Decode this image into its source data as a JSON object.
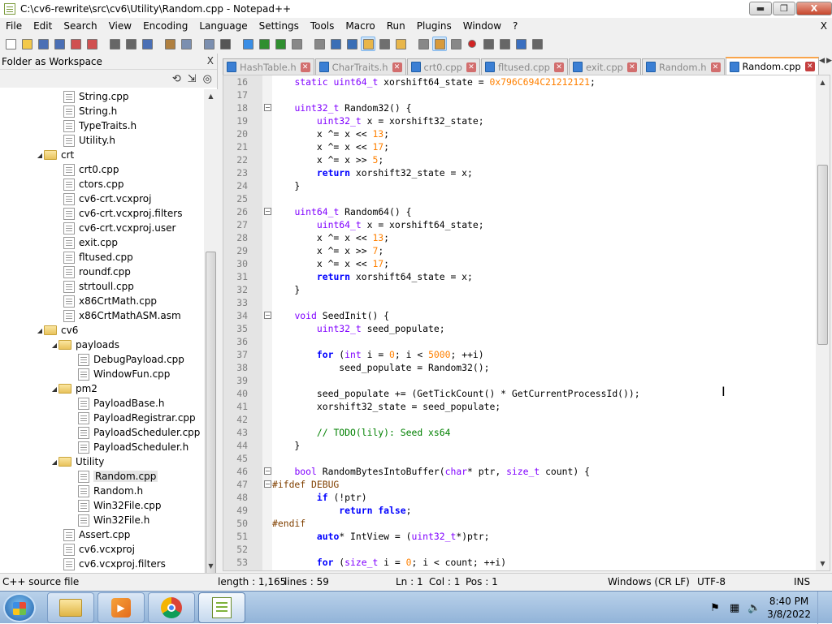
{
  "window": {
    "title": "C:\\cv6-rewrite\\src\\cv6\\Utility\\Random.cpp - Notepad++",
    "buttons": {
      "minimize": "▬",
      "maximize": "❐",
      "close": "X"
    }
  },
  "menu": {
    "items": [
      "File",
      "Edit",
      "Search",
      "View",
      "Encoding",
      "Language",
      "Settings",
      "Tools",
      "Macro",
      "Run",
      "Plugins",
      "Window",
      "?"
    ],
    "close_x": "X"
  },
  "toolbar": {
    "icons": [
      "new-file-icon",
      "open-file-icon",
      "save-icon",
      "save-all-icon",
      "close-icon",
      "close-all-icon",
      "print-icon",
      "cut-icon",
      "copy-icon",
      "paste-icon",
      "undo-icon",
      "redo-icon",
      "find-icon",
      "replace-icon",
      "zoom-in-icon",
      "zoom-out-icon",
      "sync-v-icon",
      "sync-h-icon",
      "wrap-icon",
      "all-chars-icon",
      "indent-guide-icon",
      "udl-icon",
      "doc-map-icon",
      "function-list-icon",
      "folder-workspace-icon",
      "monitor-icon",
      "record-macro-icon",
      "stop-macro-icon",
      "play-macro-icon",
      "run-macro-multi-icon",
      "save-macro-icon"
    ]
  },
  "workspace": {
    "title": "Folder as Workspace",
    "close": "X",
    "tools": [
      "⟲",
      "⇲",
      "◎"
    ],
    "tree": [
      {
        "label": "String.cpp",
        "type": "file",
        "depth": 3
      },
      {
        "label": "String.h",
        "type": "file",
        "depth": 3
      },
      {
        "label": "TypeTraits.h",
        "type": "file",
        "depth": 3
      },
      {
        "label": "Utility.h",
        "type": "file",
        "depth": 3
      },
      {
        "label": "crt",
        "type": "folder",
        "depth": 2
      },
      {
        "label": "crt0.cpp",
        "type": "file",
        "depth": 3
      },
      {
        "label": "ctors.cpp",
        "type": "file",
        "depth": 3
      },
      {
        "label": "cv6-crt.vcxproj",
        "type": "file",
        "depth": 3
      },
      {
        "label": "cv6-crt.vcxproj.filters",
        "type": "file",
        "depth": 3
      },
      {
        "label": "cv6-crt.vcxproj.user",
        "type": "file",
        "depth": 3
      },
      {
        "label": "exit.cpp",
        "type": "file",
        "depth": 3
      },
      {
        "label": "fltused.cpp",
        "type": "file",
        "depth": 3
      },
      {
        "label": "roundf.cpp",
        "type": "file",
        "depth": 3
      },
      {
        "label": "strtoull.cpp",
        "type": "file",
        "depth": 3
      },
      {
        "label": "x86CrtMath.cpp",
        "type": "file",
        "depth": 3
      },
      {
        "label": "x86CrtMathASM.asm",
        "type": "file",
        "depth": 3
      },
      {
        "label": "cv6",
        "type": "folder",
        "depth": 2
      },
      {
        "label": "payloads",
        "type": "folder",
        "depth": 3
      },
      {
        "label": "DebugPayload.cpp",
        "type": "file",
        "depth": 4
      },
      {
        "label": "WindowFun.cpp",
        "type": "file",
        "depth": 4
      },
      {
        "label": "pm2",
        "type": "folder",
        "depth": 3
      },
      {
        "label": "PayloadBase.h",
        "type": "file",
        "depth": 4
      },
      {
        "label": "PayloadRegistrar.cpp",
        "type": "file",
        "depth": 4
      },
      {
        "label": "PayloadScheduler.cpp",
        "type": "file",
        "depth": 4
      },
      {
        "label": "PayloadScheduler.h",
        "type": "file",
        "depth": 4
      },
      {
        "label": "Utility",
        "type": "folder",
        "depth": 3
      },
      {
        "label": "Random.cpp",
        "type": "file",
        "depth": 4,
        "selected": true
      },
      {
        "label": "Random.h",
        "type": "file",
        "depth": 4
      },
      {
        "label": "Win32File.cpp",
        "type": "file",
        "depth": 4
      },
      {
        "label": "Win32File.h",
        "type": "file",
        "depth": 4
      },
      {
        "label": "Assert.cpp",
        "type": "file",
        "depth": 3
      },
      {
        "label": "cv6.vcxproj",
        "type": "file",
        "depth": 3
      },
      {
        "label": "cv6.vcxproj.filters",
        "type": "file",
        "depth": 3
      }
    ]
  },
  "tabs": [
    {
      "label": "HashTable.h",
      "active": false
    },
    {
      "label": "CharTraits.h",
      "active": false
    },
    {
      "label": "crt0.cpp",
      "active": false
    },
    {
      "label": "fltused.cpp",
      "active": false
    },
    {
      "label": "exit.cpp",
      "active": false
    },
    {
      "label": "Random.h",
      "active": false
    },
    {
      "label": "Random.cpp",
      "active": true
    }
  ],
  "editor": {
    "lines": [
      {
        "n": "16",
        "fold": false,
        "html": "    <span class='ty'>static</span> <span class='ty'>uint64_t</span> xorshift64_state = <span class='nu'>0x796C694C21212121</span>;"
      },
      {
        "n": "17",
        "fold": false,
        "html": ""
      },
      {
        "n": "18",
        "fold": true,
        "html": "    <span class='ty'>uint32_t</span> Random32() {"
      },
      {
        "n": "19",
        "fold": false,
        "html": "        <span class='ty'>uint32_t</span> x = xorshift32_state;"
      },
      {
        "n": "20",
        "fold": false,
        "html": "        x ^= x &lt;&lt; <span class='nu'>13</span>;"
      },
      {
        "n": "21",
        "fold": false,
        "html": "        x ^= x &lt;&lt; <span class='nu'>17</span>;"
      },
      {
        "n": "22",
        "fold": false,
        "html": "        x ^= x &gt;&gt; <span class='nu'>5</span>;"
      },
      {
        "n": "23",
        "fold": false,
        "html": "        <span class='kw'>return</span> xorshift32_state = x;"
      },
      {
        "n": "24",
        "fold": false,
        "html": "    }"
      },
      {
        "n": "25",
        "fold": false,
        "html": ""
      },
      {
        "n": "26",
        "fold": true,
        "html": "    <span class='ty'>uint64_t</span> Random64() {"
      },
      {
        "n": "27",
        "fold": false,
        "html": "        <span class='ty'>uint64_t</span> x = xorshift64_state;"
      },
      {
        "n": "28",
        "fold": false,
        "html": "        x ^= x &lt;&lt; <span class='nu'>13</span>;"
      },
      {
        "n": "29",
        "fold": false,
        "html": "        x ^= x &gt;&gt; <span class='nu'>7</span>;"
      },
      {
        "n": "30",
        "fold": false,
        "html": "        x ^= x &lt;&lt; <span class='nu'>17</span>;"
      },
      {
        "n": "31",
        "fold": false,
        "html": "        <span class='kw'>return</span> xorshift64_state = x;"
      },
      {
        "n": "32",
        "fold": false,
        "html": "    }"
      },
      {
        "n": "33",
        "fold": false,
        "html": ""
      },
      {
        "n": "34",
        "fold": true,
        "html": "    <span class='ty'>void</span> SeedInit() {"
      },
      {
        "n": "35",
        "fold": false,
        "html": "        <span class='ty'>uint32_t</span> seed_populate;"
      },
      {
        "n": "36",
        "fold": false,
        "html": ""
      },
      {
        "n": "37",
        "fold": false,
        "html": "        <span class='kw'>for</span> (<span class='ty'>int</span> i = <span class='nu'>0</span>; i &lt; <span class='nu'>5000</span>; ++i)"
      },
      {
        "n": "38",
        "fold": false,
        "html": "            seed_populate = Random32();"
      },
      {
        "n": "39",
        "fold": false,
        "html": ""
      },
      {
        "n": "40",
        "fold": false,
        "html": "        seed_populate += (GetTickCount() * GetCurrentProcessId());"
      },
      {
        "n": "41",
        "fold": false,
        "html": "        xorshift32_state = seed_populate;"
      },
      {
        "n": "42",
        "fold": false,
        "html": ""
      },
      {
        "n": "43",
        "fold": false,
        "html": "        <span class='cm'>// TODO(lily): Seed xs64</span>"
      },
      {
        "n": "44",
        "fold": false,
        "html": "    }"
      },
      {
        "n": "45",
        "fold": false,
        "html": ""
      },
      {
        "n": "46",
        "fold": true,
        "html": "    <span class='ty'>bool</span> RandomBytesIntoBuffer(<span class='ty'>char</span>* ptr, <span class='ty'>size_t</span> count) {"
      },
      {
        "n": "47",
        "fold": true,
        "html": "<span class='pp'>#ifdef DEBUG</span>"
      },
      {
        "n": "48",
        "fold": false,
        "html": "        <span class='kw'>if</span> (!ptr)"
      },
      {
        "n": "49",
        "fold": false,
        "html": "            <span class='kw'>return</span> <span class='kw'>false</span>;"
      },
      {
        "n": "50",
        "fold": false,
        "html": "<span class='pp'>#endif</span>"
      },
      {
        "n": "51",
        "fold": false,
        "html": "        <span class='kw'>auto</span>* IntView = (<span class='ty'>uint32_t</span>*)ptr;"
      },
      {
        "n": "52",
        "fold": false,
        "html": ""
      },
      {
        "n": "53",
        "fold": false,
        "html": "        <span class='kw'>for</span> (<span class='ty'>size_t</span> i = <span class='nu'>0</span>; i &lt; count; ++i)"
      }
    ]
  },
  "status": {
    "filetype": "C++ source file",
    "length": "length : 1,165",
    "lines": "lines : 59",
    "ln": "Ln : 1",
    "col": "Col : 1",
    "pos": "Pos : 1",
    "eol": "Windows (CR LF)",
    "encoding": "UTF-8",
    "mode": "INS"
  },
  "taskbar": {
    "time": "8:40 PM",
    "date": "3/8/2022",
    "apps": [
      "explorer-icon",
      "media-player-icon",
      "chrome-icon",
      "notepad-plus-plus-icon"
    ]
  },
  "colors": {
    "keyword": "#0000ff",
    "type": "#8000ff",
    "number": "#ff8000",
    "comment": "#008000",
    "preprocessor": "#804000",
    "active_tab_accent": "#f9a54b"
  }
}
